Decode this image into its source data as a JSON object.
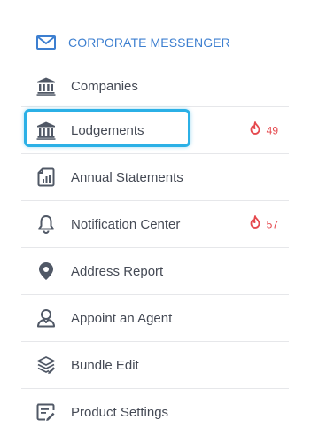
{
  "header": {
    "icon": "envelope-icon",
    "label": "CORPORATE MESSENGER"
  },
  "menu_items": [
    {
      "label": "Companies",
      "icon": "bank-icon"
    },
    {
      "label": "Lodgements",
      "icon": "bank-icon",
      "badge": "49",
      "badge_icon": "flame-icon",
      "highlighted": true
    },
    {
      "label": "Annual Statements",
      "icon": "document-chart-icon"
    },
    {
      "label": "Notification Center",
      "icon": "bell-icon",
      "badge": "57",
      "badge_icon": "flame-icon"
    },
    {
      "label": "Address Report",
      "icon": "location-pin-icon"
    },
    {
      "label": "Appoint an Agent",
      "icon": "person-icon"
    },
    {
      "label": "Bundle Edit",
      "icon": "layers-icon"
    },
    {
      "label": "Product Settings",
      "icon": "settings-list-icon"
    }
  ],
  "colors": {
    "accent": "#3d7fd0",
    "badge": "#e5484d",
    "highlight": "#2bb0e6",
    "icon": "#505866"
  }
}
